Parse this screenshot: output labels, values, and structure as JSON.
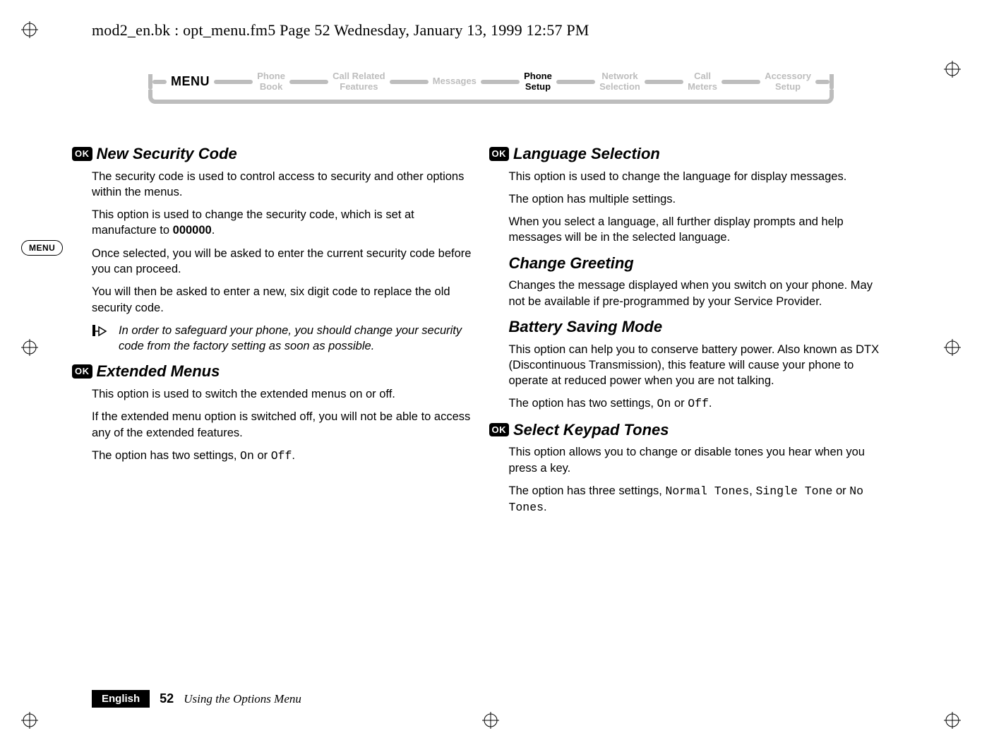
{
  "header_line": "mod2_en.bk : opt_menu.fm5  Page 52  Wednesday, January 13, 1999  12:57 PM",
  "menu": {
    "label": "MENU",
    "tabs": [
      {
        "l1": "Phone",
        "l2": "Book",
        "active": false
      },
      {
        "l1": "Call Related",
        "l2": "Features",
        "active": false
      },
      {
        "l1": "Messages",
        "l2": "",
        "active": false
      },
      {
        "l1": "Phone",
        "l2": "Setup",
        "active": true
      },
      {
        "l1": "Network",
        "l2": "Selection",
        "active": false
      },
      {
        "l1": "Call",
        "l2": "Meters",
        "active": false
      },
      {
        "l1": "Accessory",
        "l2": "Setup",
        "active": false
      }
    ]
  },
  "menu_badge": "MENU",
  "left": {
    "s1": {
      "ok": "OK",
      "title": "New Security Code",
      "p1": "The security code is used to control access to security and other options within the menus.",
      "p2a": "This option is used to change the security code, which is set at manufacture to ",
      "p2b": "000000",
      "p2c": ".",
      "p3": "Once selected, you will be asked to enter the current security code before you can proceed.",
      "p4": "You will then be asked to enter a new, six digit code to replace the old security code.",
      "note": "In order to safeguard your phone, you should change your security code from the factory setting as soon as possible."
    },
    "s2": {
      "ok": "OK",
      "title": "Extended Menus",
      "p1": "This option is used to switch the extended menus on or off.",
      "p2": "If the extended menu option is switched off, you will not be able to access any of the extended features.",
      "p3a": "The option has two settings, ",
      "p3on": "On",
      "p3mid": " or ",
      "p3off": "Off",
      "p3end": "."
    }
  },
  "right": {
    "s1": {
      "ok": "OK",
      "title": "Language Selection",
      "p1": "This option is used to change the language for display messages.",
      "p2": "The option has multiple settings.",
      "p3": "When you select a language, all further display prompts and help messages will be in the selected language."
    },
    "s2": {
      "title": "Change Greeting",
      "p1": "Changes the message displayed when you switch on your phone. May not be available if pre-programmed by your Service Provider."
    },
    "s3": {
      "title": "Battery Saving Mode",
      "p1": "This option can help you to conserve battery power. Also known as DTX (Discontinuous Transmission), this feature will cause your phone to operate at reduced power when you are not talking.",
      "p2a": "The option has two settings, ",
      "p2on": "On",
      "p2mid": " or ",
      "p2off": "Off",
      "p2end": "."
    },
    "s4": {
      "ok": "OK",
      "title": "Select Keypad Tones",
      "p1": "This option allows you to change or disable tones you hear when you press a key.",
      "p2a": "The option has three settings, ",
      "p2b": "Normal Tones",
      "p2c": ", ",
      "p2d": "Single Tone",
      "p2e": " or ",
      "p2f": "No Tones",
      "p2g": "."
    }
  },
  "footer": {
    "lang": "English",
    "page": "52",
    "section": "Using the Options Menu"
  }
}
